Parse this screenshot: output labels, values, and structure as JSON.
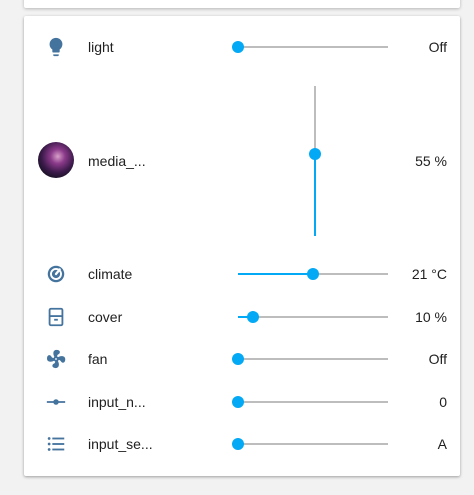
{
  "entities": [
    {
      "id": "light",
      "name": "light",
      "icon": "lightbulb-icon",
      "state": "Off",
      "value": 0,
      "orientation": "horizontal"
    },
    {
      "id": "media",
      "name": "media_...",
      "icon": "media-player-avatar",
      "state": "55 %",
      "value": 0.55,
      "orientation": "vertical"
    },
    {
      "id": "climate",
      "name": "climate",
      "icon": "thermostat-icon",
      "state": "21 °C",
      "value": 0.5,
      "orientation": "horizontal"
    },
    {
      "id": "cover",
      "name": "cover",
      "icon": "window-shutter-icon",
      "state": "10 %",
      "value": 0.1,
      "orientation": "horizontal"
    },
    {
      "id": "fan",
      "name": "fan",
      "icon": "fan-icon",
      "state": "Off",
      "value": 0,
      "orientation": "horizontal"
    },
    {
      "id": "input_number",
      "name": "input_n...",
      "icon": "ray-vertex-icon",
      "state": "0",
      "value": 0,
      "orientation": "horizontal"
    },
    {
      "id": "input_select",
      "name": "input_se...",
      "icon": "format-list-bulleted-icon",
      "state": "A",
      "value": 0,
      "orientation": "horizontal"
    }
  ],
  "colors": {
    "accent": "#03a9f4",
    "icon": "#44739e",
    "track": "#bdbdbd",
    "card": "#ffffff",
    "background": "#f2f2f2"
  }
}
